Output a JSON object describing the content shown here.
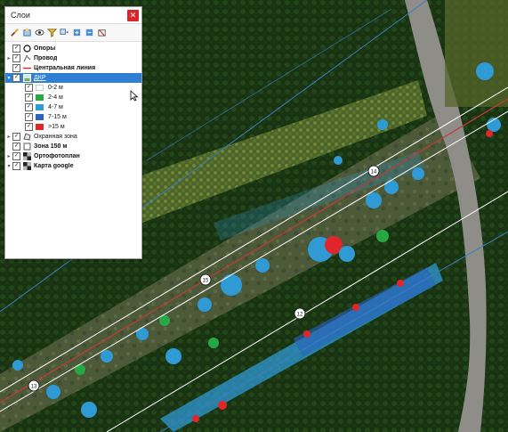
{
  "window": {
    "title": "Слои",
    "close_glyph": "✕"
  },
  "toolbar": {
    "buttons": [
      {
        "name": "style-brush-icon"
      },
      {
        "name": "add-group-icon"
      },
      {
        "name": "eye-icon"
      },
      {
        "name": "filter-icon"
      },
      {
        "name": "filter-dropdown-icon"
      },
      {
        "name": "expand-all-icon"
      },
      {
        "name": "collapse-all-icon"
      },
      {
        "name": "remove-layer-icon"
      }
    ]
  },
  "layers": [
    {
      "label": "Опоры",
      "icon": "point-circle-icon",
      "bold": true,
      "checked": true,
      "expander": ""
    },
    {
      "label": "Провод",
      "icon": "line-style-icon",
      "bold": true,
      "checked": true,
      "expander": "▸"
    },
    {
      "label": "Центральная линия",
      "icon": "red-line-icon",
      "bold": true,
      "checked": true,
      "expander": ""
    },
    {
      "label": "ДКР",
      "icon": "raster-icon",
      "bold": false,
      "checked": true,
      "expander": "▾",
      "selected": true
    },
    {
      "label": "Охранная зона",
      "icon": "polygon-icon",
      "bold": false,
      "checked": true,
      "expander": "▸"
    },
    {
      "label": "Зона 150 м",
      "icon": "polygon-white-icon",
      "bold": true,
      "checked": true,
      "expander": ""
    },
    {
      "label": "Ортофотоплан",
      "icon": "raster-checker-icon",
      "bold": true,
      "checked": true,
      "expander": "▸"
    },
    {
      "label": "Карта google",
      "icon": "raster-checker-icon",
      "bold": true,
      "checked": true,
      "expander": "▾"
    }
  ],
  "legend": [
    {
      "label": "0-2 м",
      "color": "#ffffff"
    },
    {
      "label": "2-4 м",
      "color": "#27a844"
    },
    {
      "label": "4-7 м",
      "color": "#2f9ad4"
    },
    {
      "label": "7-15 м",
      "color": "#2b63c2"
    },
    {
      "label": ">15 м",
      "color": "#e0262b"
    }
  ],
  "map": {
    "tower_labels": [
      "14",
      "15",
      "12",
      "13"
    ]
  }
}
